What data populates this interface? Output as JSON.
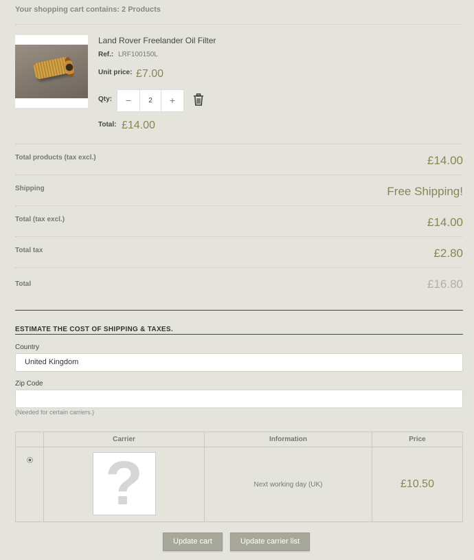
{
  "cart": {
    "summary": "Your shopping cart contains: 2 Products"
  },
  "product": {
    "name": "Land Rover Freelander Oil Filter",
    "ref_label": "Ref.:",
    "ref_value": "LRF100150L",
    "unit_price_label": "Unit price:",
    "unit_price": "£7.00",
    "qty_label": "Qty:",
    "qty_minus": "−",
    "qty_value": "2",
    "qty_plus": "+",
    "total_label": "Total:",
    "total": "£14.00",
    "image_icon": "oil-filter-photo",
    "remove_icon": "trash-icon"
  },
  "totals": [
    {
      "label": "Total products (tax excl.)",
      "value": "£14.00"
    },
    {
      "label": "Shipping",
      "value": "Free Shipping!"
    },
    {
      "label": "Total (tax excl.)",
      "value": "£14.00"
    },
    {
      "label": "Total tax",
      "value": "£2.80"
    },
    {
      "label": "Total",
      "value": "£16.80"
    }
  ],
  "estimate": {
    "title": "ESTIMATE THE COST OF SHIPPING & TAXES.",
    "country_label": "Country",
    "country_value": "United Kingdom",
    "zip_label": "Zip Code",
    "zip_value": "",
    "zip_hint": "(Needed for certain carriers.)"
  },
  "carriers": {
    "headers": [
      "",
      "Carrier",
      "Information",
      "Price"
    ],
    "rows": [
      {
        "selected": true,
        "logo_icon": "question-mark-placeholder",
        "logo_glyph": "?",
        "information": "Next working day (UK)",
        "price": "£10.50"
      }
    ]
  },
  "buttons": {
    "update_cart": "Update cart",
    "update_carrier_list": "Update carrier list"
  },
  "colors": {
    "background": "#e4e4dc",
    "price": "#8a8455",
    "button": "#a8a89a"
  }
}
